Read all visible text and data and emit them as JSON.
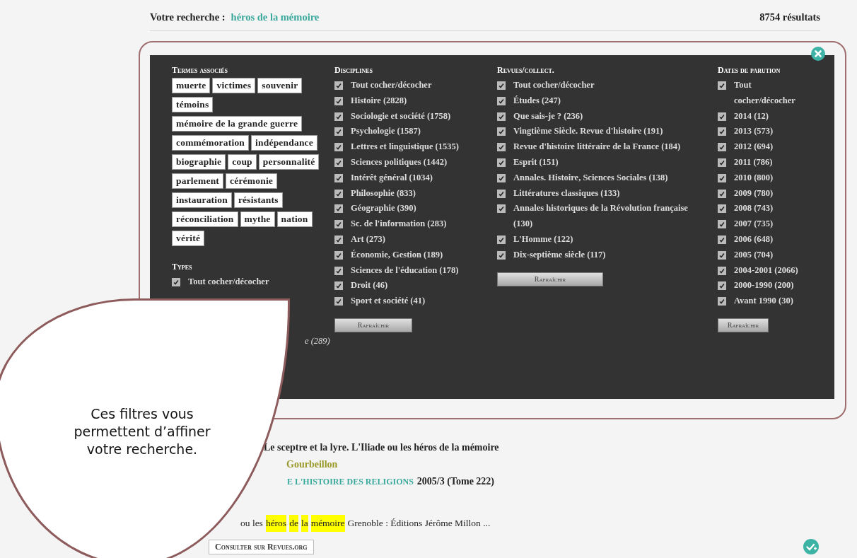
{
  "search": {
    "label": "Votre recherche :",
    "query": "héros de la mémoire",
    "count": "8754 résultats"
  },
  "filters": {
    "terms": {
      "title": "Termes associés",
      "tags": [
        "muerte",
        "victimes",
        "souvenir",
        "témoins",
        "mémoire de la grande guerre",
        "commémoration",
        "indépendance",
        "biographie",
        "coup",
        "personnalité",
        "parlement",
        "cérémonie",
        "instauration",
        "résistants",
        "réconciliation",
        "mythe",
        "nation",
        "vérité"
      ]
    },
    "types": {
      "title": "Types",
      "items": [
        {
          "kind": "full",
          "label": "Tout cocher/décocher",
          "checked": true
        },
        {
          "kind": "partial",
          "label": "e (289)"
        }
      ]
    },
    "disciplines": {
      "title": "Disciplines",
      "items": [
        {
          "label": "Tout cocher/décocher",
          "checked": true
        },
        {
          "label": "Histoire (2828)",
          "checked": true
        },
        {
          "label": "Sociologie et société (1758)",
          "checked": true
        },
        {
          "label": "Psychologie (1587)",
          "checked": true
        },
        {
          "label": "Lettres et linguistique (1535)",
          "checked": true
        },
        {
          "label": "Sciences politiques (1442)",
          "checked": true
        },
        {
          "label": "Intérêt général (1034)",
          "checked": true
        },
        {
          "label": "Philosophie (833)",
          "checked": true
        },
        {
          "label": "Géographie (390)",
          "checked": true
        },
        {
          "label": "Sc. de l'information (283)",
          "checked": true
        },
        {
          "label": "Art (273)",
          "checked": true
        },
        {
          "label": "Économie, Gestion (189)",
          "checked": true
        },
        {
          "label": "Sciences de l'éducation (178)",
          "checked": true
        },
        {
          "label": "Droit (46)",
          "checked": true
        },
        {
          "label": "Sport et société (41)",
          "checked": true
        }
      ],
      "button": "Rafraîchir"
    },
    "revues": {
      "title": "Revues/collect.",
      "items": [
        {
          "label": "Tout cocher/décocher",
          "checked": true
        },
        {
          "label": "Études (247)",
          "checked": true
        },
        {
          "label": "Que sais-je ? (236)",
          "checked": true
        },
        {
          "label": "Vingtième Siècle. Revue d'histoire (191)",
          "checked": true
        },
        {
          "label": "Revue d'histoire littéraire de la France (184)",
          "checked": true
        },
        {
          "label": "Esprit (151)",
          "checked": true
        },
        {
          "label": "Annales. Histoire, Sciences Sociales (138)",
          "checked": true
        },
        {
          "label": "Littératures classiques (133)",
          "checked": true
        },
        {
          "label": "Annales historiques de la Révolution française (130)",
          "checked": true
        },
        {
          "label": "L'Homme (122)",
          "checked": true
        },
        {
          "label": "Dix-septième siècle (117)",
          "checked": true
        }
      ],
      "button": "Rafraîchir"
    },
    "dates": {
      "title": "Dates de parution",
      "items": [
        {
          "label": "Tout cocher/décocher",
          "checked": true
        },
        {
          "label": "2014 (12)",
          "checked": true
        },
        {
          "label": "2013 (573)",
          "checked": true
        },
        {
          "label": "2012 (694)",
          "checked": true
        },
        {
          "label": "2011 (786)",
          "checked": true
        },
        {
          "label": "2010 (800)",
          "checked": true
        },
        {
          "label": "2009 (780)",
          "checked": true
        },
        {
          "label": "2008 (743)",
          "checked": true
        },
        {
          "label": "2007 (735)",
          "checked": true
        },
        {
          "label": "2006 (648)",
          "checked": true
        },
        {
          "label": "2005 (704)",
          "checked": true
        },
        {
          "label": "2004-2001 (2066)",
          "checked": true
        },
        {
          "label": "2000-1990 (200)",
          "checked": true
        },
        {
          "label": "Avant 1990 (30)",
          "checked": true
        }
      ],
      "button": "Rafraîchir"
    }
  },
  "callout": {
    "text": "Ces filtres vous permettent d’affiner votre recherche."
  },
  "result": {
    "title": "Le sceptre et la lyre. L'Iliade ou les héros de la mémoire",
    "author": "Gourbeillon",
    "journal": "E L'HISTOIRE DES RELIGIONS",
    "issue": "2005/3 (Tome 222)",
    "excerpt": [
      {
        "text": "ou les",
        "highlight": false
      },
      {
        "text": "héros",
        "highlight": true
      },
      {
        "text": "de",
        "highlight": true
      },
      {
        "text": "la",
        "highlight": true
      },
      {
        "text": "mémoire",
        "highlight": true
      },
      {
        "text": "Grenoble : Éditions Jérôme Millon ...",
        "highlight": false
      }
    ],
    "button": "Consulter sur Revues.org"
  }
}
